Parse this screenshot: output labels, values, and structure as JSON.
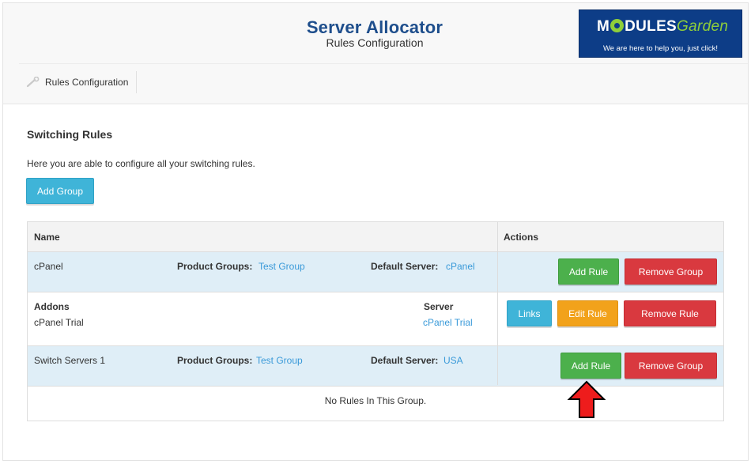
{
  "header": {
    "title": "Server Allocator",
    "subtitle": "Rules Configuration"
  },
  "logo": {
    "brand_left": "M",
    "brand_mid": "DULES",
    "brand_right": "Garden",
    "tagline": "We are here to help you, just click!"
  },
  "nav": {
    "icon": "wrench-icon",
    "label": "Rules Configuration"
  },
  "section": {
    "title": "Switching Rules",
    "description": "Here you are able to configure all your switching rules.",
    "add_group_label": "Add Group"
  },
  "table": {
    "col_name": "Name",
    "col_actions": "Actions",
    "groups": [
      {
        "name": "cPanel",
        "product_groups_label": "Product Groups:",
        "product_groups_value": "Test Group",
        "default_server_label": "Default Server:",
        "default_server_value": "cPanel",
        "add_rule_label": "Add Rule",
        "remove_group_label": "Remove Group"
      },
      {
        "name": "Switch Servers 1",
        "product_groups_label": "Product Groups:",
        "product_groups_value": "Test Group",
        "default_server_label": "Default Server:",
        "default_server_value": "USA",
        "add_rule_label": "Add Rule",
        "remove_group_label": "Remove Group",
        "empty_message": "No Rules In This Group."
      }
    ],
    "rules": [
      {
        "addons_label": "Addons",
        "addons_value": "cPanel Trial",
        "server_label": "Server",
        "server_value": "cPanel Trial",
        "links_label": "Links",
        "edit_label": "Edit Rule",
        "remove_label": "Remove Rule"
      }
    ]
  },
  "colors": {
    "title": "#1e4e8c",
    "link": "#3a9ad9",
    "info": "#3fb4d8",
    "success": "#4cb04c",
    "danger": "#d9393f",
    "warning": "#f2a21b",
    "group_row": "#dfeef7",
    "arrow": "#ee1c1c"
  },
  "annotation": {
    "icon": "red-up-arrow-icon"
  }
}
